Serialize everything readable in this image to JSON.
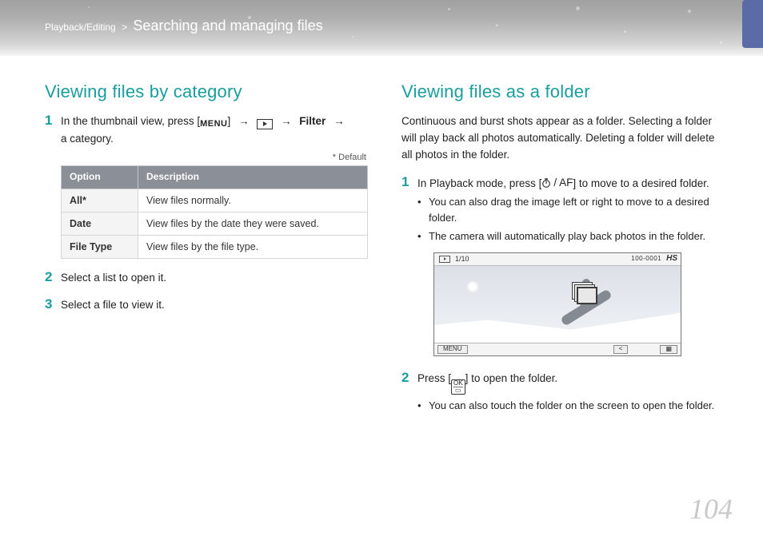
{
  "header": {
    "breadcrumb_section": "Playback/Editing",
    "breadcrumb_sep": ">",
    "breadcrumb_title": "Searching and managing files"
  },
  "left": {
    "heading": "Viewing files by category",
    "step1_num": "1",
    "step1_pre": "In the thumbnail view, press [",
    "step1_menu": "MENU",
    "step1_mid1": "] ",
    "arrow": "→",
    "step1_filter": "Filter",
    "step1_tail": "a category.",
    "default_note": "* Default",
    "table": {
      "h1": "Option",
      "h2": "Description",
      "rows": [
        {
          "opt": "All*",
          "desc": "View files normally."
        },
        {
          "opt": "Date",
          "desc": "View files by the date they were saved."
        },
        {
          "opt": "File Type",
          "desc": "View files by the file type."
        }
      ]
    },
    "step2_num": "2",
    "step2_text": "Select a list to open it.",
    "step3_num": "3",
    "step3_text": "Select a file to view it."
  },
  "right": {
    "heading": "Viewing files as a folder",
    "intro": "Continuous and burst shots appear as a folder. Selecting a folder will play back all photos automatically. Deleting a folder will delete all photos in the folder.",
    "step1_num": "1",
    "step1_pre": "In Playback mode, press [",
    "step1_af": "AF",
    "step1_post": "] to move to a desired folder.",
    "step1_sub1": "You can also drag the image left or right to move to a desired folder.",
    "step1_sub2": "The camera will automatically play back photos in the folder.",
    "screenshot": {
      "counter": "1/10",
      "fileno": "100-0001",
      "hs": "HS",
      "menu": "MENU",
      "back": "<",
      "grid": "▦"
    },
    "step2_num": "2",
    "step2_pre": "Press [",
    "step2_ok_top": "OK",
    "step2_ok_bot": "▭",
    "step2_post": "] to open the folder.",
    "step2_sub1": "You can also touch the folder on the screen to open the folder."
  },
  "page_number": "104"
}
